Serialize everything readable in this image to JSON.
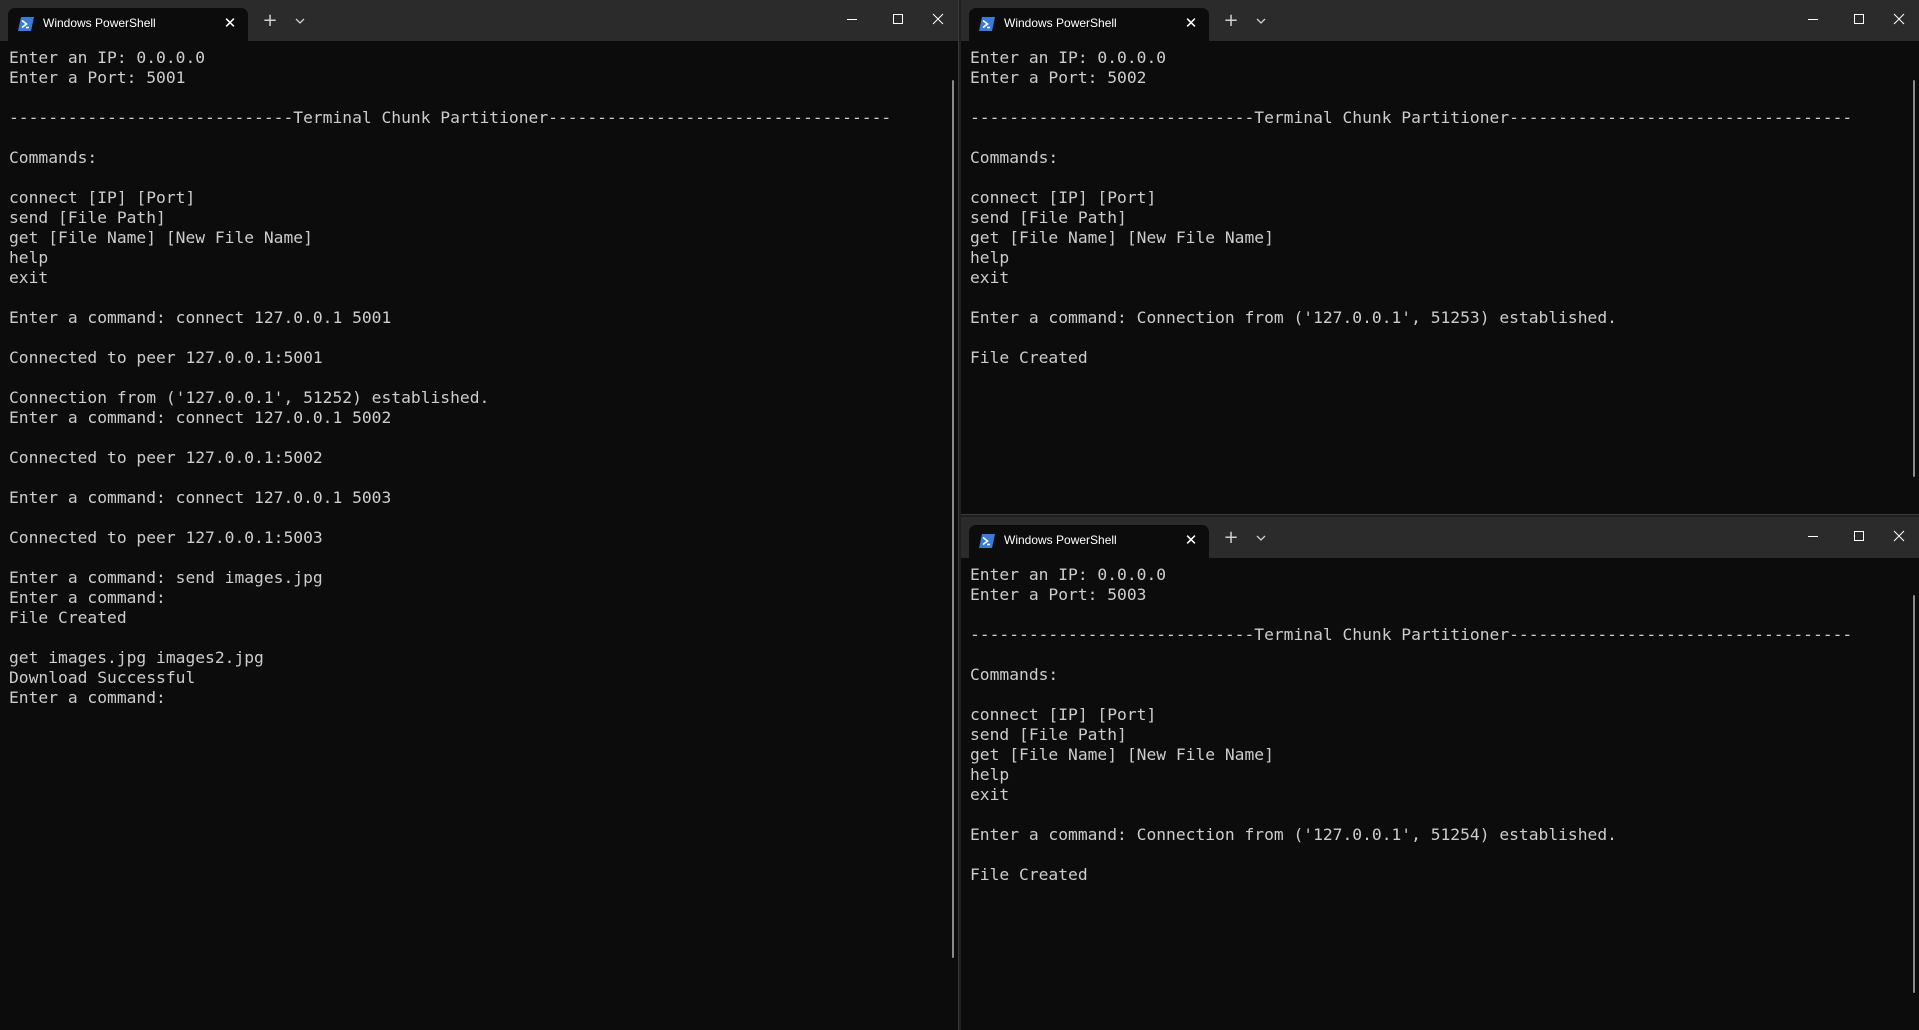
{
  "windows": [
    {
      "id": "win1",
      "tab_title": "Windows PowerShell",
      "lines": [
        "Enter an IP: 0.0.0.0",
        "Enter a Port: 5001",
        "",
        "-----------------------------Terminal Chunk Partitioner-----------------------------------",
        "",
        "Commands:",
        "",
        "connect [IP] [Port]",
        "send [File Path]",
        "get [File Name] [New File Name]",
        "help",
        "exit",
        "",
        "Enter a command: connect 127.0.0.1 5001",
        "",
        "Connected to peer 127.0.0.1:5001",
        "",
        "Connection from ('127.0.0.1', 51252) established.",
        "Enter a command: connect 127.0.0.1 5002",
        "",
        "Connected to peer 127.0.0.1:5002",
        "",
        "Enter a command: connect 127.0.0.1 5003",
        "",
        "Connected to peer 127.0.0.1:5003",
        "",
        "Enter a command: send images.jpg",
        "Enter a command:",
        "File Created",
        "",
        "get images.jpg images2.jpg",
        "Download Successful",
        "Enter a command:"
      ]
    },
    {
      "id": "win2",
      "tab_title": "Windows PowerShell",
      "lines": [
        "Enter an IP: 0.0.0.0",
        "Enter a Port: 5002",
        "",
        "-----------------------------Terminal Chunk Partitioner-----------------------------------",
        "",
        "Commands:",
        "",
        "connect [IP] [Port]",
        "send [File Path]",
        "get [File Name] [New File Name]",
        "help",
        "exit",
        "",
        "Enter a command: Connection from ('127.0.0.1', 51253) established.",
        "",
        "File Created"
      ]
    },
    {
      "id": "win3",
      "tab_title": "Windows PowerShell",
      "lines": [
        "Enter an IP: 0.0.0.0",
        "Enter a Port: 5003",
        "",
        "-----------------------------Terminal Chunk Partitioner-----------------------------------",
        "",
        "Commands:",
        "",
        "connect [IP] [Port]",
        "send [File Path]",
        "get [File Name] [New File Name]",
        "help",
        "exit",
        "",
        "Enter a command: Connection from ('127.0.0.1', 51254) established.",
        "",
        "File Created"
      ]
    }
  ],
  "icons": {
    "tab_icon": "powershell-icon",
    "new_tab": "plus-icon",
    "dropdown": "chevron-down-icon",
    "minimize": "minimize-icon",
    "maximize": "maximize-icon",
    "close": "close-icon"
  },
  "colors": {
    "terminal_bg": "#0c0c0c",
    "terminal_fg": "#cccccc",
    "titlebar_bg": "#2b2b2b",
    "powershell_icon": "#3a7bd5"
  }
}
